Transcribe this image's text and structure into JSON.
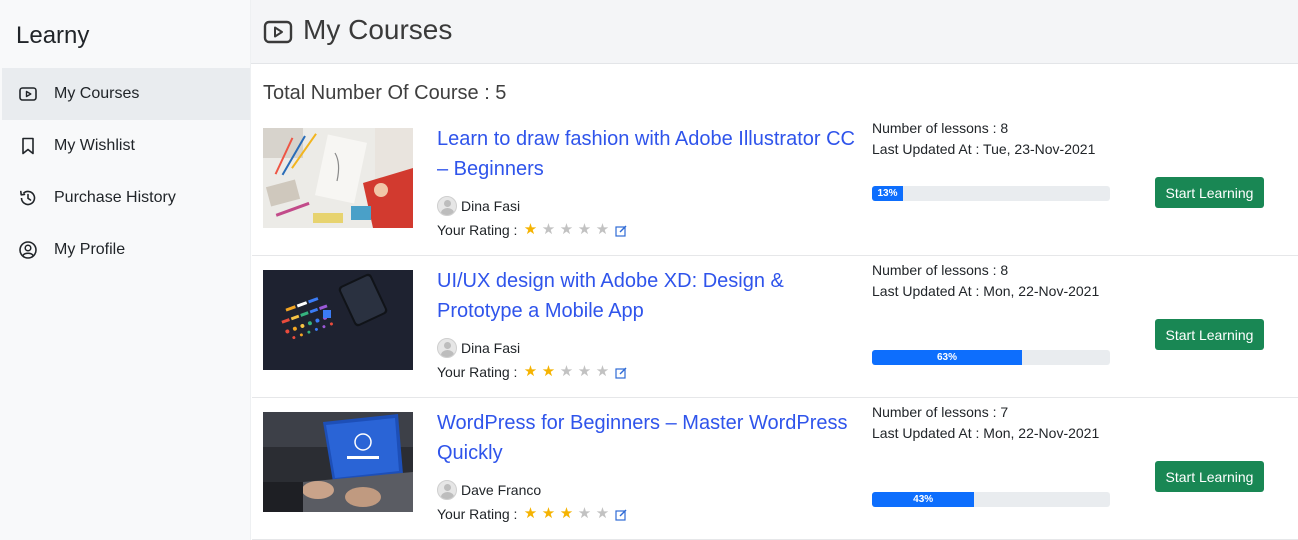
{
  "brand": "Learny",
  "sidebar": {
    "items": [
      {
        "label": "My Courses",
        "icon": "play-video-icon",
        "active": true
      },
      {
        "label": "My Wishlist",
        "icon": "bookmark-icon",
        "active": false
      },
      {
        "label": "Purchase History",
        "icon": "history-icon",
        "active": false
      },
      {
        "label": "My Profile",
        "icon": "user-circle-icon",
        "active": false
      }
    ]
  },
  "header": {
    "title": "My Courses",
    "icon": "play-video-icon"
  },
  "total_label": "Total Number Of Course : 5",
  "colors": {
    "link": "#2f54eb",
    "button": "#198754",
    "progress": "#0d6efd",
    "star": "#f5b301"
  },
  "rating_label": "Your Rating :",
  "courses": [
    {
      "title": "Learn to draw fashion with Adobe Illustrator CC – Beginners",
      "instructor": "Dina Fasi",
      "lessons": "Number of lessons : 8",
      "updated": "Last Updated At : Tue, 23-Nov-2021",
      "progress": 13,
      "progress_label": "13%",
      "rating": 1,
      "button": "Start Learning"
    },
    {
      "title": "UI/UX design with Adobe XD: Design & Prototype a Mobile App",
      "instructor": "Dina Fasi",
      "lessons": "Number of lessons : 8",
      "updated": "Last Updated At : Mon, 22-Nov-2021",
      "progress": 63,
      "progress_label": "63%",
      "rating": 2,
      "button": "Start Learning"
    },
    {
      "title": "WordPress for Beginners – Master WordPress Quickly",
      "instructor": "Dave Franco",
      "lessons": "Number of lessons : 7",
      "updated": "Last Updated At : Mon, 22-Nov-2021",
      "progress": 43,
      "progress_label": "43%",
      "rating": 3,
      "button": "Start Learning"
    }
  ]
}
